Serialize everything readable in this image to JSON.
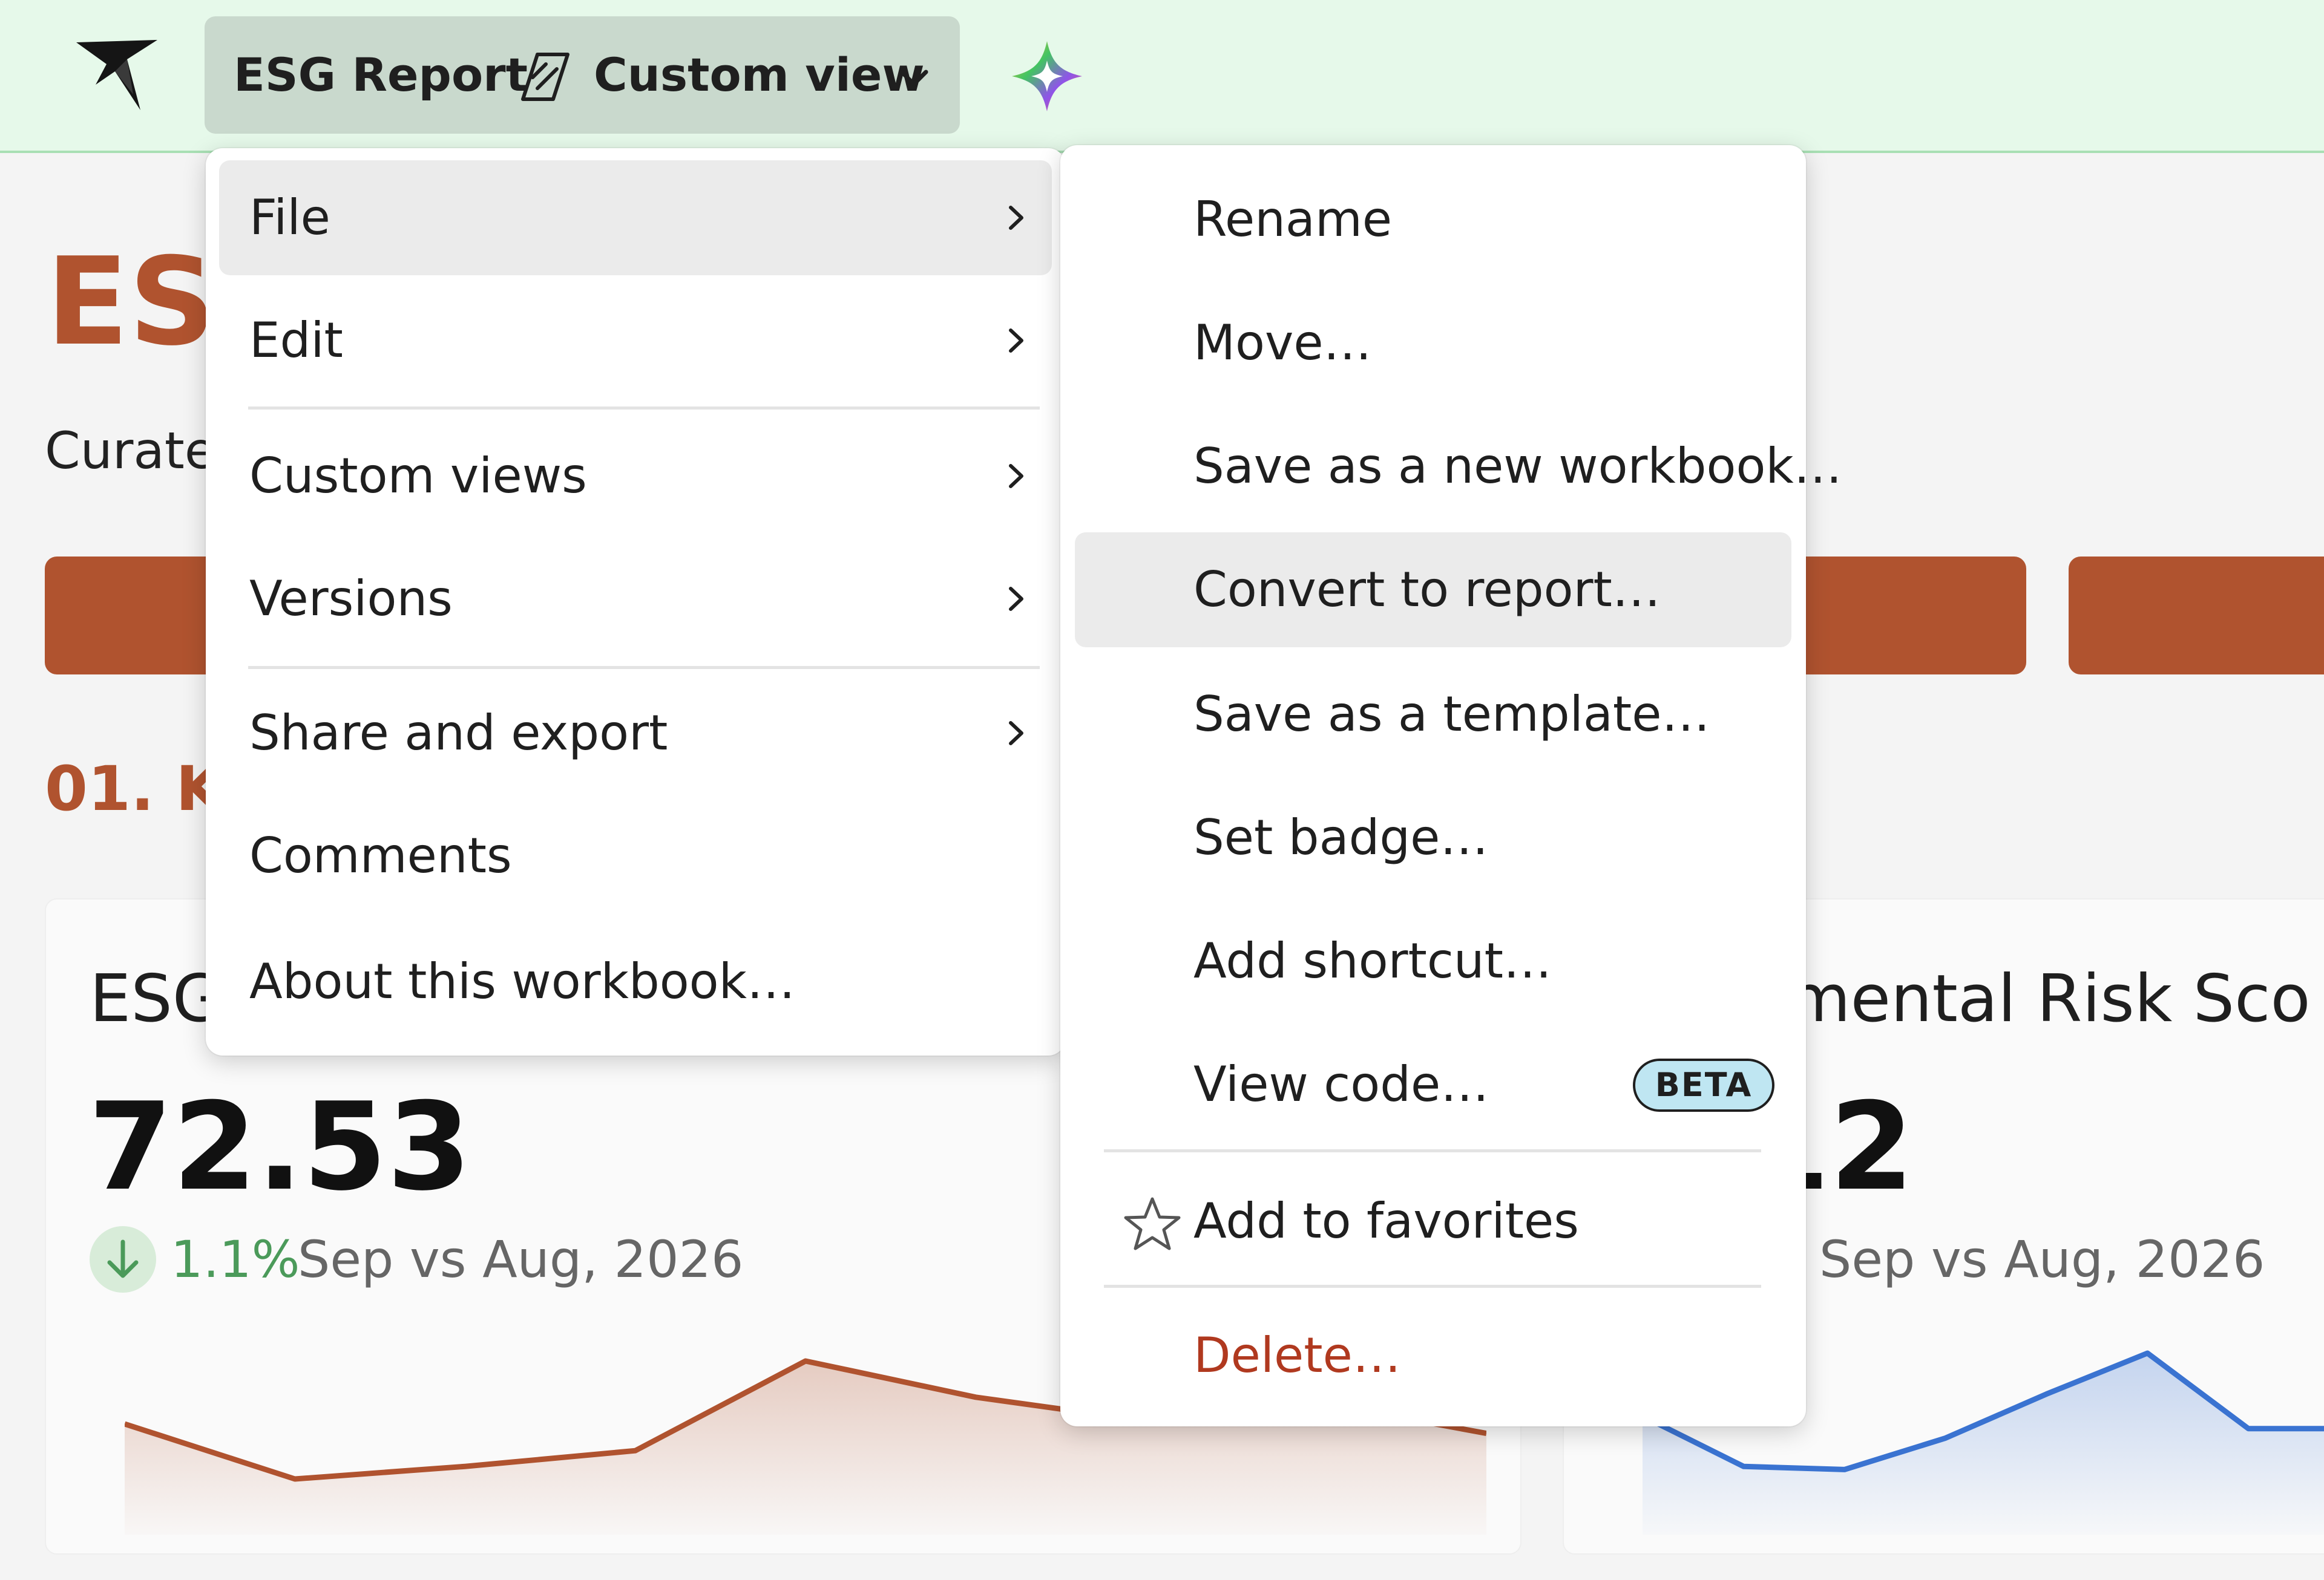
{
  "header": {
    "workbook_title": "ESG Report",
    "view_name": "Custom view",
    "icons": {
      "logo": "bird-logo-icon",
      "view": "custom-view-icon",
      "dropdown": "chevron-down-icon",
      "ai": "ai-sparkle-icon"
    }
  },
  "page": {
    "title_visible": "ES",
    "subtitle_visible": "Curate",
    "section_visible": "01. K"
  },
  "cards": [
    {
      "title_visible": "ESG",
      "value": "72.53",
      "change": "1.1%",
      "period": "Sep vs Aug, 2026",
      "trend": "down",
      "color": "#b0532f",
      "sparkline": [
        55,
        20,
        28,
        38,
        95,
        72,
        57,
        69,
        49
      ]
    },
    {
      "title_visible": "nmental Risk Sco",
      "value_visible": "12",
      "period": "Sep vs Aug, 2026",
      "color": "#3a73d1",
      "sparkline": [
        60,
        28,
        26,
        46,
        74,
        100,
        52,
        52
      ]
    }
  ],
  "menu": {
    "items": [
      {
        "label": "File",
        "submenu": true,
        "active": true
      },
      {
        "label": "Edit",
        "submenu": true
      },
      {
        "label": "Custom views",
        "submenu": true
      },
      {
        "label": "Versions",
        "submenu": true
      },
      {
        "label": "Share and export",
        "submenu": true
      },
      {
        "label": "Comments",
        "submenu": false
      },
      {
        "label": "About this workbook…",
        "submenu": false
      }
    ]
  },
  "file_menu": {
    "items": [
      {
        "label": "Rename"
      },
      {
        "label": "Move…"
      },
      {
        "label": "Save as a new workbook…"
      },
      {
        "label": "Convert to report…",
        "active": true
      },
      {
        "label": "Save as a template…"
      },
      {
        "label": "Set badge…"
      },
      {
        "label": "Add shortcut…"
      },
      {
        "label": "View code…",
        "badge": "BETA"
      },
      {
        "label": "Add to favorites",
        "icon": "star-icon"
      },
      {
        "label": "Delete…",
        "danger": true
      }
    ]
  },
  "colors": {
    "accent": "#b0532f",
    "topbar": "#e6f9ea",
    "danger": "#b0391f",
    "beta_badge": "#bfe6f2",
    "positive": "#4b9a5a"
  }
}
